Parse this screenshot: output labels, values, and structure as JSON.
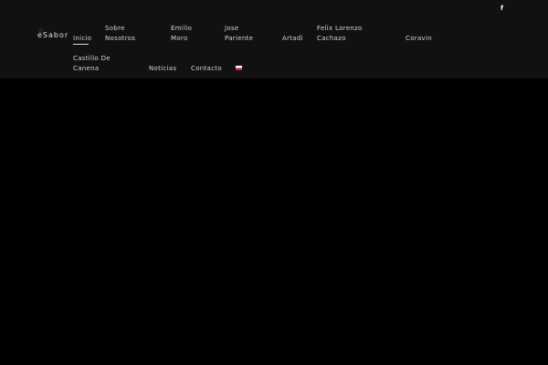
{
  "logo": {
    "mark": "d",
    "text": "eSabor"
  },
  "social": {
    "facebook_icon": "f"
  },
  "nav": {
    "inicio": "Inicio",
    "sobre": [
      "Sobre",
      "Nosotros"
    ],
    "emilio": [
      "Emilio",
      "Moro"
    ],
    "jose": [
      "Jose",
      "Pariente"
    ],
    "artadi": "Artadi",
    "felix": [
      "Felix Lorenzo",
      "Cachazo"
    ],
    "coravin": "Coravin",
    "castillo": [
      "Castillo De",
      "Canena"
    ],
    "noticias": "Noticias",
    "contacto": "Contacto"
  },
  "colors": {
    "header_bg": "#111111",
    "accent": "#a3161b"
  }
}
